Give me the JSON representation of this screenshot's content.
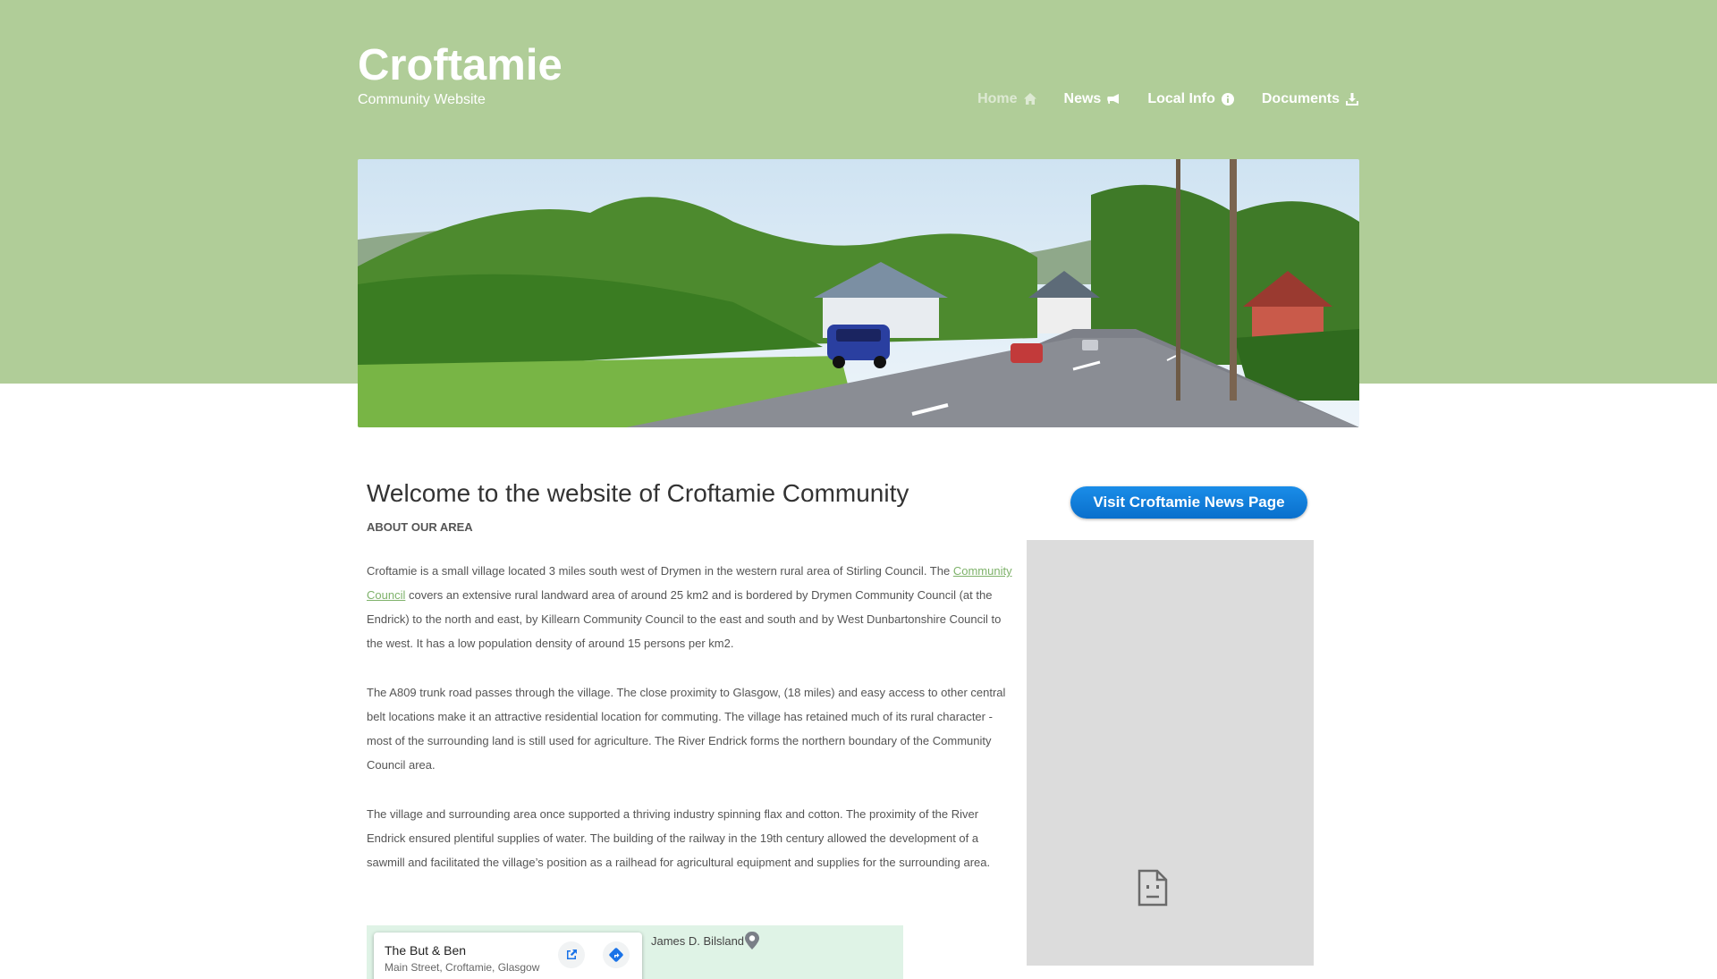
{
  "site": {
    "title": "Croftamie",
    "subtitle": "Community Website"
  },
  "nav": {
    "items": [
      {
        "label": "Home",
        "icon": "home-icon",
        "active": true
      },
      {
        "label": "News",
        "icon": "megaphone-icon",
        "active": false
      },
      {
        "label": "Local Info",
        "icon": "info-circle-icon",
        "active": false
      },
      {
        "label": "Documents",
        "icon": "download-icon",
        "active": false
      }
    ]
  },
  "banner": {
    "description_icon": "village-road-photo"
  },
  "main": {
    "title": "Welcome to the website of Croftamie Community",
    "section_heading": "ABOUT OUR AREA",
    "p1_before_link": "Croftamie is a small village located 3 miles south west of Drymen in the western rural area of Stirling Council.  The ",
    "p1_link": "Community Council",
    "p1_after_link": " covers an extensive rural landward area of around 25 km2 and is bordered by Drymen Community Council (at the Endrick) to the north and east, by Killearn Community Council to the east and south and by West Dunbartonshire Council to the west.  It has a low population density of around 15 persons per km2.",
    "p2": "The A809 trunk road passes through the village.  The close proximity to Glasgow, (18 miles) and easy access to other central belt locations make it an attractive residential location for commuting.  The village has retained much of its rural character - most of the surrounding land is still used for agriculture.  The River Endrick forms the northern boundary of the Community Council area.",
    "p3": "The village and surrounding area once supported a thriving industry spinning flax and cotton. The proximity of the River Endrick ensured plentiful supplies of water.  The building of the railway in the 19th century allowed the development of a sawmill and facilitated the village’s position as a railhead for agricultural equipment and supplies for the surrounding area."
  },
  "map": {
    "place_name": "The But & Ben",
    "place_address": "Main Street, Croftamie, Glasgow",
    "nearby_label": "James D. Bilsland"
  },
  "sidebar": {
    "news_button_label": "Visit Croftamie News Page",
    "embed_icon": "broken-document-icon"
  },
  "colors": {
    "header_green": "#b0cd98",
    "link_green": "#7eb26a",
    "button_blue": "#0a6fcc",
    "panel_grey": "#dcdcdc"
  }
}
